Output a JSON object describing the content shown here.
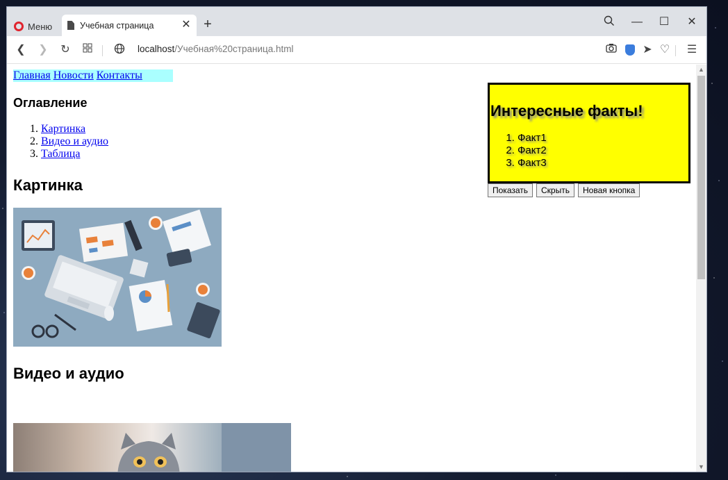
{
  "browser": {
    "menu_label": "Меню",
    "tab_title": "Учебная страница",
    "url_host": "localhost",
    "url_path": "/Учебная%20страница.html",
    "icons": [
      "back-icon",
      "forward-icon",
      "reload-icon",
      "speed-dial-icon",
      "globe-icon",
      "camera-icon",
      "shield-icon",
      "send-icon",
      "heart-icon",
      "settings-icon",
      "search-icon",
      "minimize-icon",
      "maximize-icon",
      "close-icon"
    ]
  },
  "nav": {
    "links": [
      "Главная",
      "Новости",
      "Контакты"
    ]
  },
  "toc": {
    "heading": "Оглавление",
    "items": [
      "Картинка",
      "Видео и аудио",
      "Таблица"
    ]
  },
  "picture_section": {
    "heading": "Картинка"
  },
  "video_section": {
    "heading": "Видео и аудио"
  },
  "facts": {
    "heading": "Интересные факты!",
    "items": [
      "Факт1",
      "Факт2",
      "Факт3"
    ],
    "background": "#ffff00"
  },
  "buttons": {
    "show": "Показать",
    "hide": "Скрыть",
    "new": "Новая кнопка"
  },
  "colors": {
    "nav_bg": "#aaffff",
    "link": "#0000ee",
    "opera_red": "#e0242e",
    "vpn_blue": "#3b7ddd"
  }
}
